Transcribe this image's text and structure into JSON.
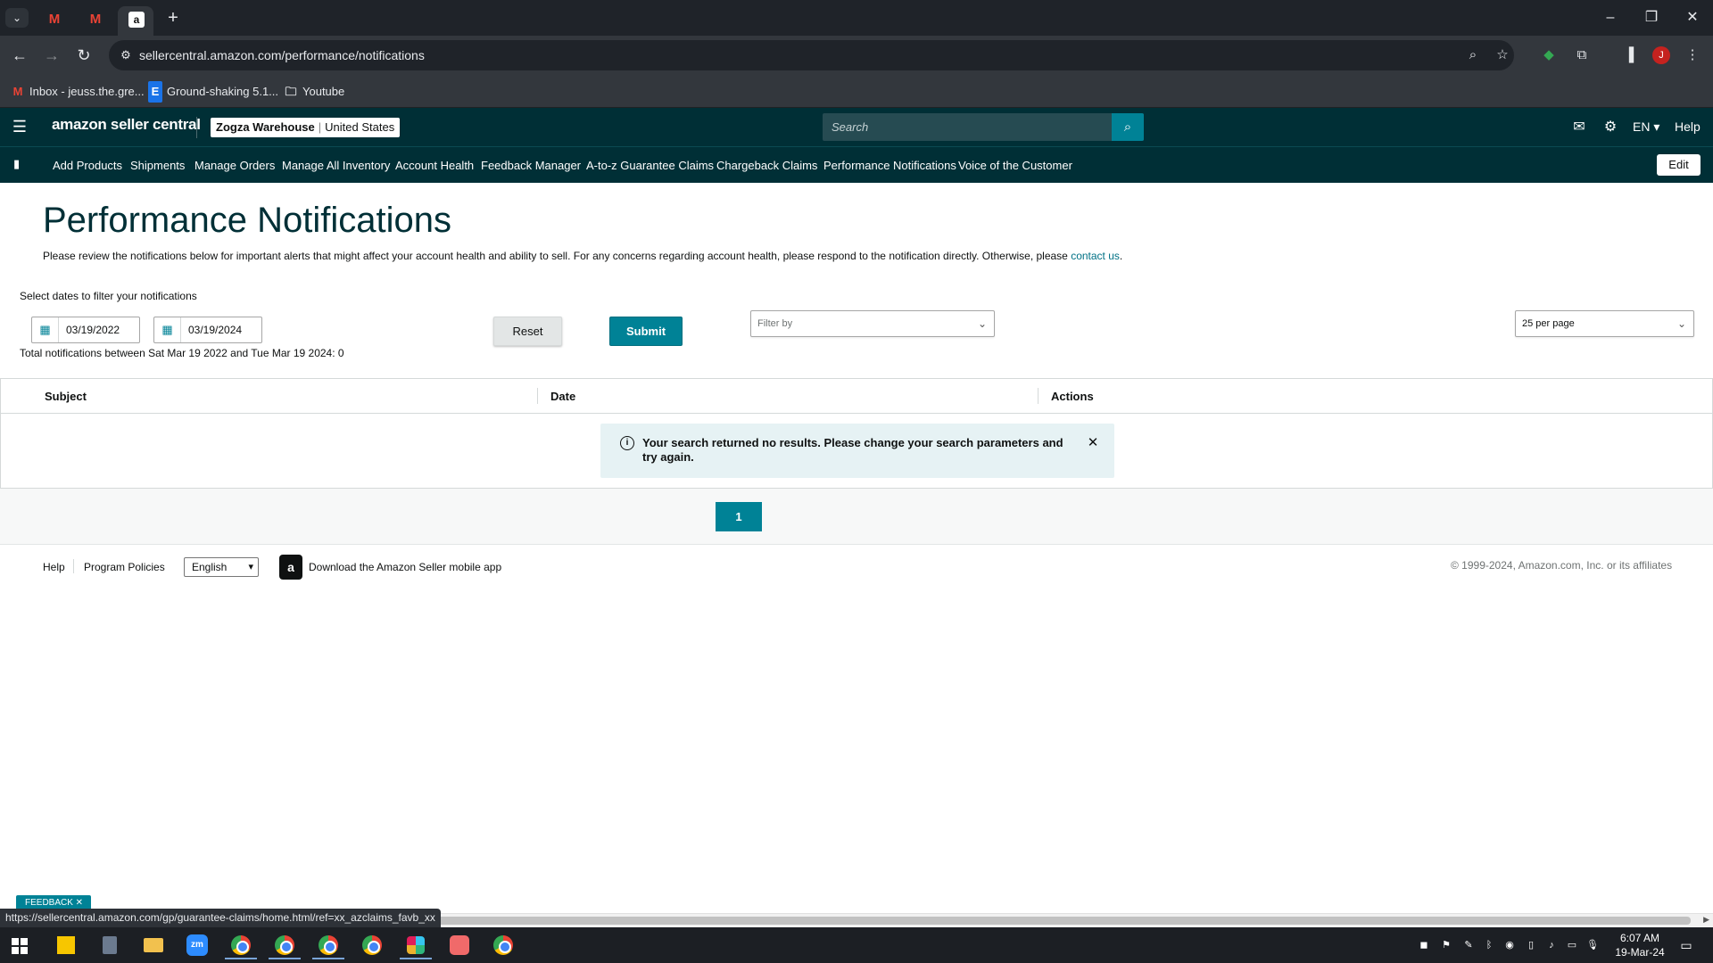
{
  "browser": {
    "tabs": [
      {
        "icon": "gmail-icon",
        "active": false
      },
      {
        "icon": "gmail-icon",
        "active": false
      },
      {
        "icon": "amazon-icon",
        "active": true
      }
    ],
    "url": "sellercentral.amazon.com/performance/notifications",
    "avatar_letter": "J",
    "bookmarks": [
      {
        "label": "Inbox - jeuss.the.gre...",
        "icon": "gmail-icon"
      },
      {
        "label": "Ground-shaking 5.1...",
        "icon": "e-icon"
      },
      {
        "label": "Youtube",
        "icon": "folder-icon"
      }
    ],
    "status_url": "https://sellercentral.amazon.com/gp/guarantee-claims/home.html/ref=xx_azclaims_favb_xx"
  },
  "header": {
    "logo": "amazon seller central",
    "account_name": "Zogza Warehouse",
    "marketplace": "United States",
    "search_placeholder": "Search",
    "language": "EN",
    "help": "Help"
  },
  "nav": {
    "items": [
      "Add Products",
      "Shipments",
      "Manage Orders",
      "Manage All Inventory",
      "Account Health",
      "Feedback Manager",
      "A-to-z Guarantee Claims",
      "Chargeback Claims",
      "Performance Notifications",
      "Voice of the Customer"
    ],
    "edit_label": "Edit"
  },
  "main": {
    "title": "Performance Notifications",
    "intro_text": "Please review the notifications below for important alerts that might affect your account health and ability to sell. For any concerns regarding account health, please respond to the notification directly. Otherwise, please ",
    "intro_link": "contact us",
    "intro_end": ".",
    "filter_label": "Select dates to filter your notifications",
    "start_date": "03/19/2022",
    "end_date": "03/19/2024",
    "total_text": "Total notifications between Sat Mar 19 2022 and Tue Mar 19 2024: 0",
    "reset_label": "Reset",
    "submit_label": "Submit",
    "filter_by_placeholder": "Filter by",
    "per_page": "25 per page",
    "columns": [
      "Subject",
      "Date",
      "Actions"
    ],
    "alert_message": "Your search returned no results. Please change your search parameters and try again.",
    "current_page": "1"
  },
  "footer": {
    "help": "Help",
    "program_policies": "Program Policies",
    "language": "English",
    "download_app": "Download the Amazon Seller mobile app",
    "copyright": "© 1999-2024, Amazon.com, Inc. or its affiliates"
  },
  "feedback_tab": "FEEDBACK ✕",
  "taskbar": {
    "time": "6:07 AM",
    "date": "19-Mar-24"
  },
  "colors": {
    "header_bg": "#002f36",
    "accent": "#008296",
    "link": "#007185"
  }
}
